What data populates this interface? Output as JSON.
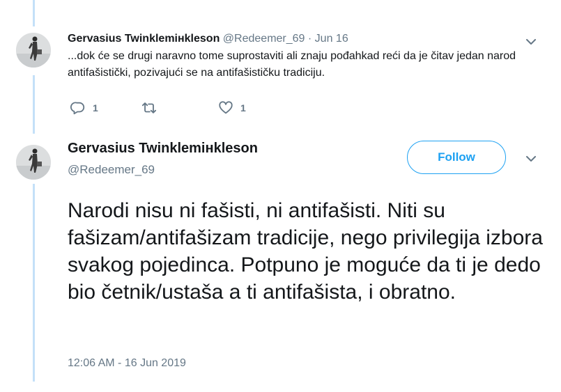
{
  "reply_tweet": {
    "author_name": "Gervasius Twinklemінkleson",
    "handle": "@Redeemer_69",
    "separator": "·",
    "date": "Jun 16",
    "text": "...dok će se drugi naravno tome suprostaviti ali znaju pođahkad reći da je čitav jedan narod antifašistički, pozivajući se na antifašističku tradiciju.",
    "actions": {
      "reply_count": "1",
      "retweet_count": "",
      "like_count": "1"
    }
  },
  "main_tweet": {
    "author_name": "Gervasius Twinklemінkleson",
    "handle": "@Redeemer_69",
    "follow_label": "Follow",
    "text": "Narodi nisu ni fašisti, ni antifašisti. Niti su fašizam/antifašizam tradicije, nego privilegija izbora svakog pojedinca. Potpuno je moguće da ti je dedo bio četnik/ustaša a ti antifašista, i obratno.",
    "timestamp": "12:06 AM - 16 Jun 2019"
  },
  "icons": {
    "reply": "reply-icon",
    "retweet": "retweet-icon",
    "like": "heart-icon",
    "menu": "chevron-down-icon",
    "avatar": "avatar"
  },
  "colors": {
    "accent": "#1da1f2",
    "thread_line": "#c4e0f8",
    "secondary_text": "#657786",
    "primary_text": "#14171a"
  }
}
